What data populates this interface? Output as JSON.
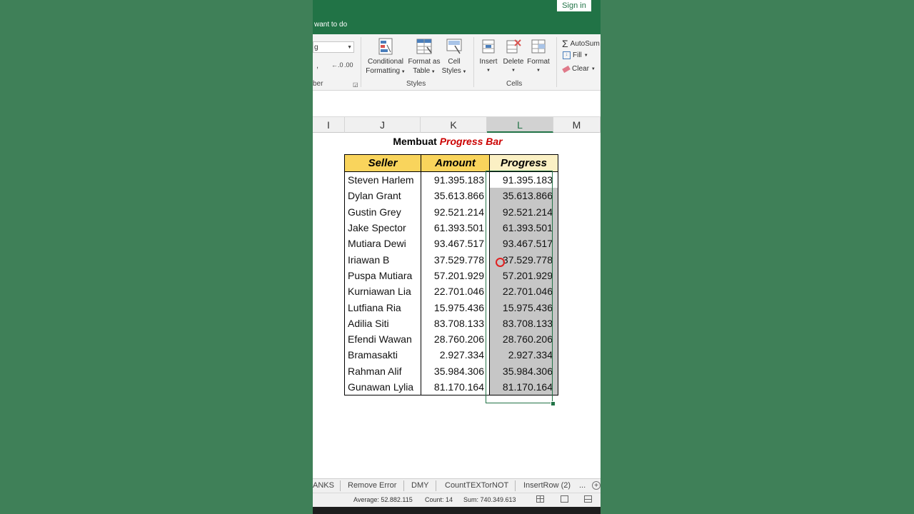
{
  "titlebar": {
    "sign_in": "Sign in",
    "tell_me": "want to do"
  },
  "ribbon": {
    "number_format_value": "g",
    "comma_style": ",",
    "increase_decimal": "←.0",
    "decrease_decimal": ".00",
    "number_group_label": "ber",
    "styles": {
      "conditional_formatting": [
        "Conditional",
        "Formatting"
      ],
      "format_as_table": [
        "Format as",
        "Table"
      ],
      "cell_styles": [
        "Cell",
        "Styles"
      ],
      "group_label": "Styles"
    },
    "cells": {
      "insert": "Insert",
      "delete": "Delete",
      "format": "Format",
      "group_label": "Cells"
    },
    "editing": {
      "autosum": "AutoSum",
      "fill": "Fill",
      "clear": "Clear"
    }
  },
  "columns": [
    "I",
    "J",
    "K",
    "L",
    "M"
  ],
  "selected_column": "L",
  "sheet": {
    "title_part1": "Membuat",
    "title_part2": "Progress Bar",
    "headers": {
      "seller": "Seller",
      "amount": "Amount",
      "progress": "Progress"
    },
    "rows": [
      {
        "seller": "Steven Harlem",
        "amount": "91.395.183",
        "progress": "91.395.183"
      },
      {
        "seller": "Dylan Grant",
        "amount": "35.613.866",
        "progress": "35.613.866"
      },
      {
        "seller": "Gustin Grey",
        "amount": "92.521.214",
        "progress": "92.521.214"
      },
      {
        "seller": "Jake Spector",
        "amount": "61.393.501",
        "progress": "61.393.501"
      },
      {
        "seller": "Mutiara Dewi",
        "amount": "93.467.517",
        "progress": "93.467.517"
      },
      {
        "seller": "Iriawan B",
        "amount": "37.529.778",
        "progress": "37.529.778"
      },
      {
        "seller": "Puspa Mutiara",
        "amount": "57.201.929",
        "progress": "57.201.929"
      },
      {
        "seller": "Kurniawan Lia",
        "amount": "22.701.046",
        "progress": "22.701.046"
      },
      {
        "seller": "Lutfiana Ria",
        "amount": "15.975.436",
        "progress": "15.975.436"
      },
      {
        "seller": "Adilia Siti",
        "amount": "83.708.133",
        "progress": "83.708.133"
      },
      {
        "seller": "Efendi Wawan",
        "amount": "28.760.206",
        "progress": "28.760.206"
      },
      {
        "seller": "Bramasakti",
        "amount": "2.927.334",
        "progress": "2.927.334"
      },
      {
        "seller": "Rahman Alif",
        "amount": "35.984.306",
        "progress": "35.984.306"
      },
      {
        "seller": "Gunawan Lylia",
        "amount": "81.170.164",
        "progress": "81.170.164"
      }
    ]
  },
  "sheet_tabs": [
    "ANKS",
    "Remove Error",
    "DMY",
    "CountTEXTorNOT",
    "InsertRow (2)",
    "..."
  ],
  "status": {
    "average": "Average: 52.882.115",
    "count": "Count: 14",
    "sum": "Sum: 740.349.613"
  },
  "colors": {
    "excel_green": "#217346",
    "header_yellow": "#f9d45c",
    "title_red": "#cc0000",
    "selection_gray": "#c6c6c6"
  }
}
